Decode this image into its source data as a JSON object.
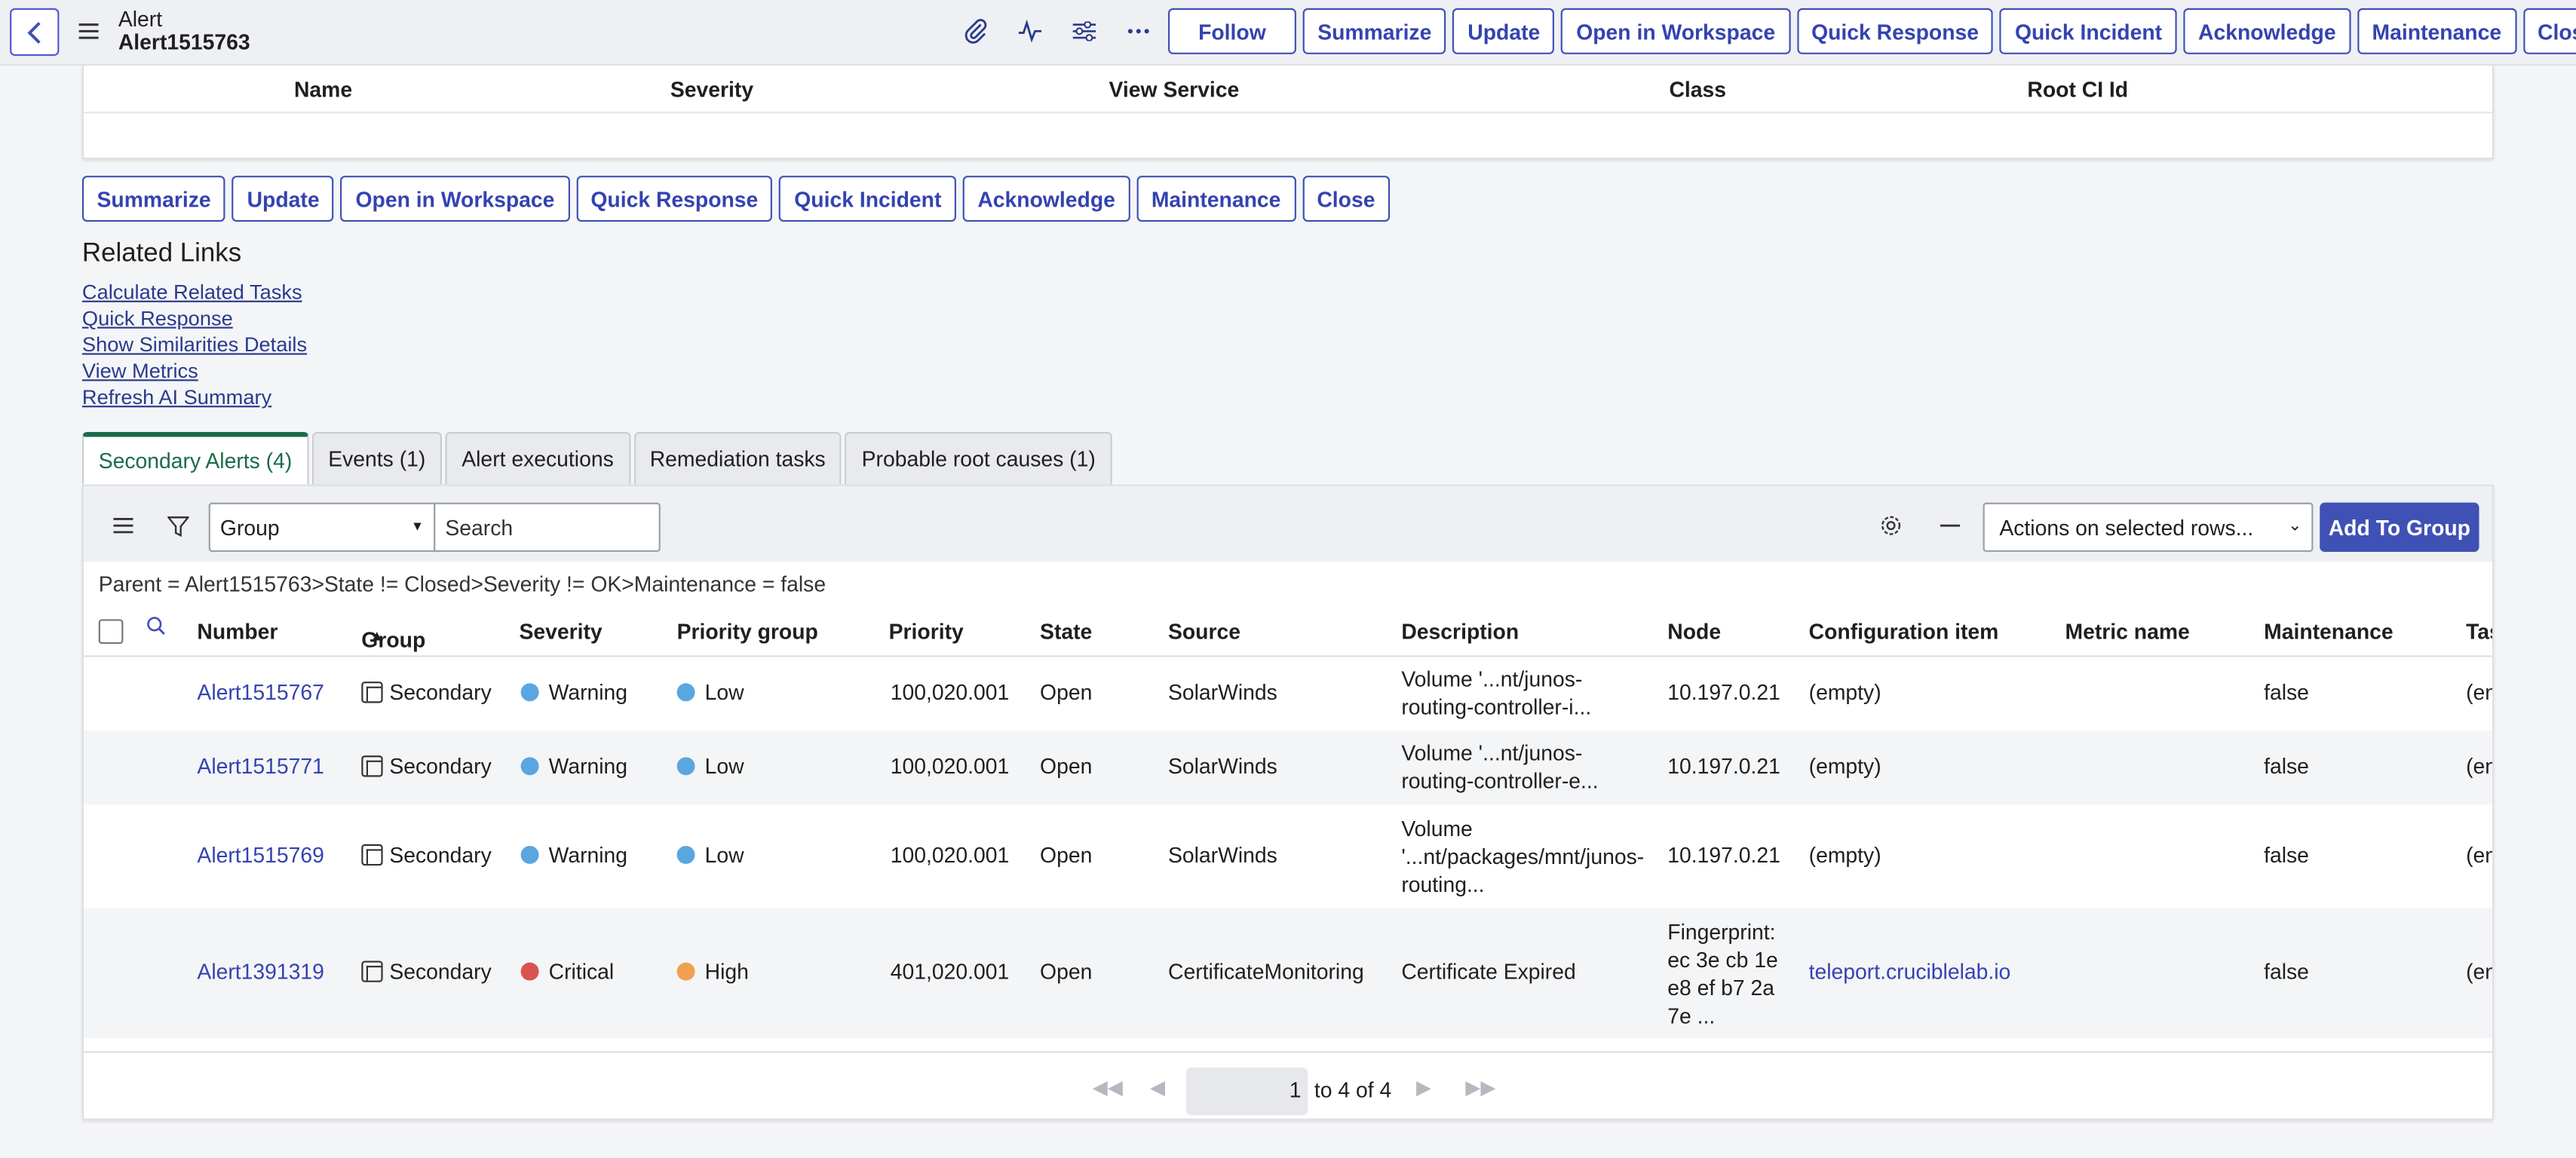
{
  "header": {
    "line1": "Alert",
    "line2": "Alert1515763",
    "buttons": [
      "Follow",
      "Summarize",
      "Update",
      "Open in Workspace",
      "Quick Response",
      "Quick Incident",
      "Acknowledge",
      "Maintenance",
      "Close"
    ]
  },
  "top_table": {
    "columns": [
      "Name",
      "Severity",
      "View Service",
      "Class",
      "Root CI Id"
    ]
  },
  "actions": [
    "Summarize",
    "Update",
    "Open in Workspace",
    "Quick Response",
    "Quick Incident",
    "Acknowledge",
    "Maintenance",
    "Close"
  ],
  "related": {
    "title": "Related Links",
    "links": [
      "Calculate Related Tasks",
      "Quick Response",
      "Show Similarities Details",
      "View Metrics",
      "Refresh AI Summary"
    ]
  },
  "tabs": [
    "Secondary Alerts (4)",
    "Events (1)",
    "Alert executions",
    "Remediation tasks",
    "Probable root causes (1)"
  ],
  "list": {
    "group_select": "Group",
    "search_placeholder": "Search",
    "actions_select": "Actions on selected rows...",
    "add_to_group": "Add To Group",
    "breadcrumb": "Parent = Alert1515763>State != Closed>Severity != OK>Maintenance = false",
    "columns": [
      "Number",
      "Group",
      "Severity",
      "Priority group",
      "Priority",
      "State",
      "Source",
      "Description",
      "Node",
      "Configuration item",
      "Metric name",
      "Maintenance",
      "Tas"
    ],
    "rows": [
      {
        "number": "Alert1515767",
        "group": "Secondary",
        "severity": "Warning",
        "priority_group": "Low",
        "priority": "100,020.001",
        "state": "Open",
        "source": "SolarWinds",
        "description": "Volume '...nt/junos-routing-controller-i...",
        "node": "10.197.0.21",
        "ci": "(empty)",
        "metric": "",
        "maintenance": "false",
        "tas": "(en"
      },
      {
        "number": "Alert1515771",
        "group": "Secondary",
        "severity": "Warning",
        "priority_group": "Low",
        "priority": "100,020.001",
        "state": "Open",
        "source": "SolarWinds",
        "description": "Volume '...nt/junos-routing-controller-e...",
        "node": "10.197.0.21",
        "ci": "(empty)",
        "metric": "",
        "maintenance": "false",
        "tas": "(en"
      },
      {
        "number": "Alert1515769",
        "group": "Secondary",
        "severity": "Warning",
        "priority_group": "Low",
        "priority": "100,020.001",
        "state": "Open",
        "source": "SolarWinds",
        "description": "Volume '...nt/packages/mnt/junos-routing...",
        "node": "10.197.0.21",
        "ci": "(empty)",
        "metric": "",
        "maintenance": "false",
        "tas": "(en"
      },
      {
        "number": "Alert1391319",
        "group": "Secondary",
        "severity": "Critical",
        "priority_group": "High",
        "priority": "401,020.001",
        "state": "Open",
        "source": "CertificateMonitoring",
        "description": "Certificate Expired",
        "node": "Fingerprint: ec 3e cb 1e e8 ef b7 2a 7e ...",
        "ci": "teleport.cruciblelab.io",
        "metric": "",
        "maintenance": "false",
        "tas": "(en"
      }
    ],
    "pager": {
      "page": "1",
      "of_text": "to 4 of 4"
    }
  },
  "colors": {
    "warning": "#5aa6e0",
    "low": "#5aa6e0",
    "critical": "#d9534f",
    "high": "#f0a050",
    "accent": "#3f51b5"
  }
}
